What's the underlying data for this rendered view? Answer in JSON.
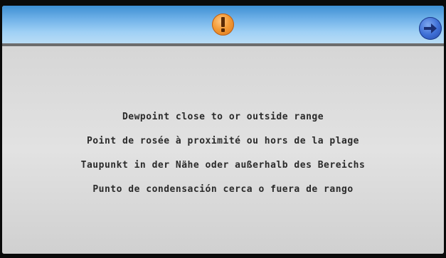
{
  "header": {
    "status_icon": "warning-icon",
    "status_color": "#f39a35",
    "next_icon": "arrow-right-icon",
    "next_color": "#3e6fd6"
  },
  "message": {
    "lines": [
      "Dewpoint close to or outside range",
      "Point de rosée à proximité ou hors de la plage",
      "Taupunkt in der Nähe oder außerhalb des Bereichs",
      "Punto de condensación cerca o fuera de rango"
    ]
  },
  "colors": {
    "header_top": "#3e8fd3",
    "header_bottom": "#b9dcf5",
    "background": "#dcdcdc",
    "text": "#2a2a2a"
  }
}
